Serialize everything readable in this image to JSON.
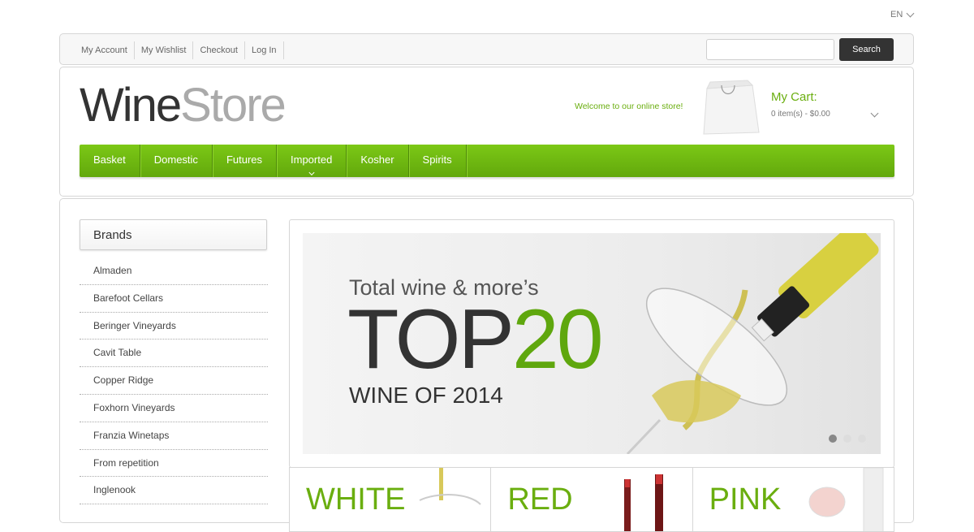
{
  "lang": {
    "label": "EN"
  },
  "toplinks": [
    "My Account",
    "My Wishlist",
    "Checkout",
    "Log In"
  ],
  "search": {
    "placeholder": "",
    "button": "Search"
  },
  "logo": {
    "part1": "Wine",
    "part2": "Store"
  },
  "welcome": "Welcome to our online store!",
  "cart": {
    "title": "My Cart:",
    "info": "0 item(s) - $0.00"
  },
  "nav": [
    {
      "label": "Basket"
    },
    {
      "label": "Domestic"
    },
    {
      "label": "Futures"
    },
    {
      "label": "Imported"
    },
    {
      "label": "Kosher"
    },
    {
      "label": "Spirits"
    }
  ],
  "brands": {
    "title": "Brands",
    "items": [
      "Almaden",
      "Barefoot Cellars",
      "Beringer Vineyards",
      "Cavit Table",
      "Copper Ridge",
      "Foxhorn Vineyards",
      "Franzia Winetaps",
      "From repetition",
      "Inglenook"
    ]
  },
  "slide": {
    "line1": "Total wine & more’s",
    "top": "TOP",
    "num": "20",
    "line3": "WINE OF 2014",
    "active_dot": 1,
    "dot_count": 3
  },
  "categories": [
    "WHITE",
    "RED",
    "PINK"
  ],
  "colors": {
    "accent": "#6aae0f",
    "nav": "#6cb711",
    "dark_button": "#333333"
  }
}
